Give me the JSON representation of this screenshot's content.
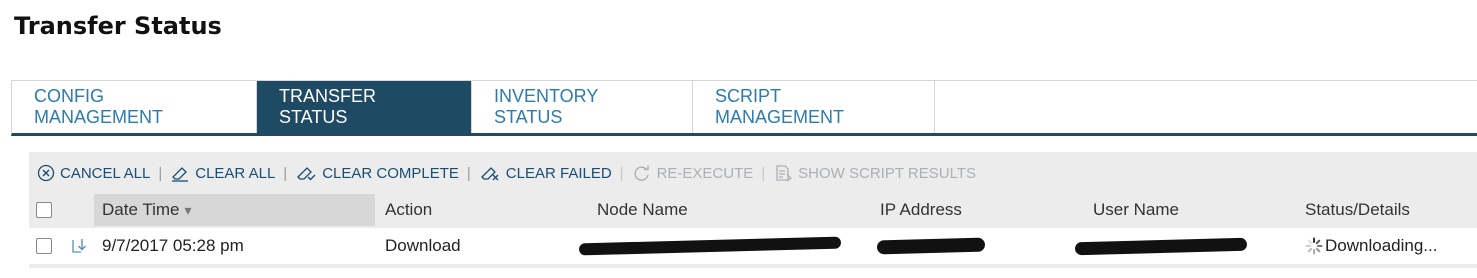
{
  "page": {
    "title": "Transfer Status"
  },
  "tabs": [
    {
      "label": "CONFIG MANAGEMENT",
      "active": false
    },
    {
      "label": "TRANSFER STATUS",
      "active": true
    },
    {
      "label": "INVENTORY STATUS",
      "active": false
    },
    {
      "label": "SCRIPT MANAGEMENT",
      "active": false
    }
  ],
  "toolbar": {
    "cancel_all": "CANCEL ALL",
    "clear_all": "CLEAR ALL",
    "clear_complete": "CLEAR COMPLETE",
    "clear_failed": "CLEAR FAILED",
    "re_execute": "RE-EXECUTE",
    "show_script_results": "SHOW SCRIPT RESULTS"
  },
  "table": {
    "columns": {
      "date_time": "Date Time",
      "action": "Action",
      "node_name": "Node Name",
      "ip_address": "IP Address",
      "user_name": "User Name",
      "status": "Status/Details"
    },
    "sort_indicator": "▾",
    "rows": [
      {
        "date_time": "9/7/2017 05:28 pm",
        "action": "Download",
        "status": "Downloading..."
      }
    ]
  },
  "colors": {
    "active_tab_bg": "#1e4a63",
    "tab_text": "#2c7bb0",
    "toolbar_text": "#1a4d73",
    "disabled_text": "#aab0b5"
  },
  "icons": {
    "cancel_all": "cancel-circle-icon",
    "clear_all": "eraser-icon",
    "clear_complete": "eraser-check-icon",
    "clear_failed": "eraser-x-icon",
    "re_execute": "refresh-icon",
    "show_script_results": "script-results-icon",
    "row_transfer": "download-arrow-icon",
    "status": "spinner-icon"
  }
}
